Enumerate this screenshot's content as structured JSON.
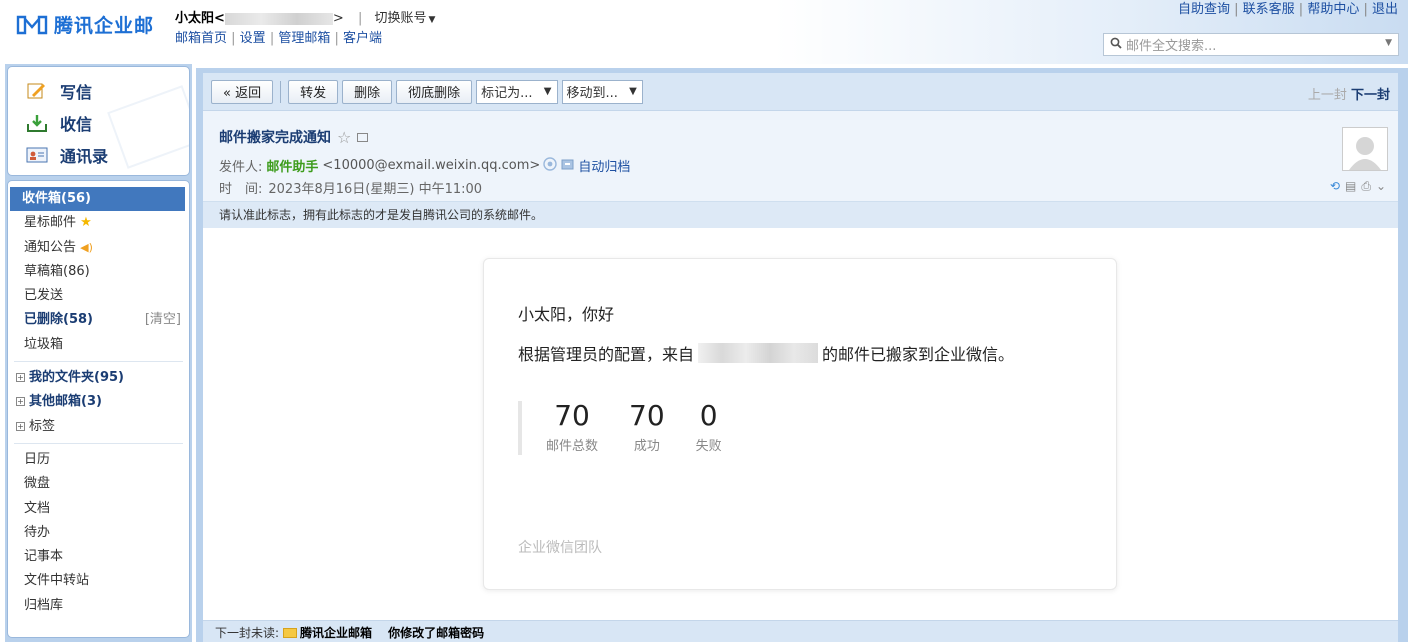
{
  "brand": {
    "name": "腾讯企业邮"
  },
  "account": {
    "name": "小太阳<",
    "suffix": ">",
    "switch_label": "切换账号"
  },
  "top_links": [
    "邮箱首页",
    "设置",
    "管理邮箱",
    "客户端"
  ],
  "right_links": [
    "自助查询",
    "联系客服",
    "帮助中心",
    "退出"
  ],
  "search": {
    "placeholder": "邮件全文搜索..."
  },
  "left_actions": [
    {
      "label": "写信",
      "icon": "write-icon"
    },
    {
      "label": "收信",
      "icon": "receive-icon"
    },
    {
      "label": "通讯录",
      "icon": "contacts-icon"
    }
  ],
  "folders": {
    "inbox": "收件箱(56)",
    "starred": "星标邮件",
    "notice": "通知公告",
    "drafts": "草稿箱(86)",
    "sent": "已发送",
    "deleted": "已删除(58)",
    "clear": "[清空]",
    "spam": "垃圾箱",
    "my_folders": "我的文件夹(95)",
    "other_mailboxes": "其他邮箱(3)",
    "tags": "标签"
  },
  "apps": [
    "日历",
    "微盘",
    "文档",
    "待办",
    "记事本",
    "文件中转站",
    "归档库"
  ],
  "toolbar": {
    "back": "« 返回",
    "forward": "转发",
    "delete": "删除",
    "delete_perm": "彻底删除",
    "mark_as": "标记为...",
    "move_to": "移动到...",
    "prev": "上一封",
    "next": "下一封"
  },
  "mail": {
    "subject": "邮件搬家完成通知",
    "from_label": "发件人:",
    "sender_name": "邮件助手",
    "sender_email": "<10000@exmail.weixin.qq.com>",
    "archive": "自动归档",
    "time_label": "时　间:",
    "time": "2023年8月16日(星期三) 中午11:00",
    "notice": "请认准此标志，拥有此标志的才是发自腾讯公司的系统邮件。"
  },
  "content": {
    "greeting": "小太阳，你好",
    "body_pre": "根据管理员的配置，来自",
    "body_post": "的邮件已搬家到企业微信。",
    "stats": [
      {
        "value": "70",
        "label": "邮件总数"
      },
      {
        "value": "70",
        "label": "成功"
      },
      {
        "value": "0",
        "label": "失败"
      }
    ],
    "signature": "企业微信团队"
  },
  "bottom": {
    "label": "下一封未读:",
    "sender": "腾讯企业邮箱",
    "subject": "你修改了邮箱密码"
  }
}
